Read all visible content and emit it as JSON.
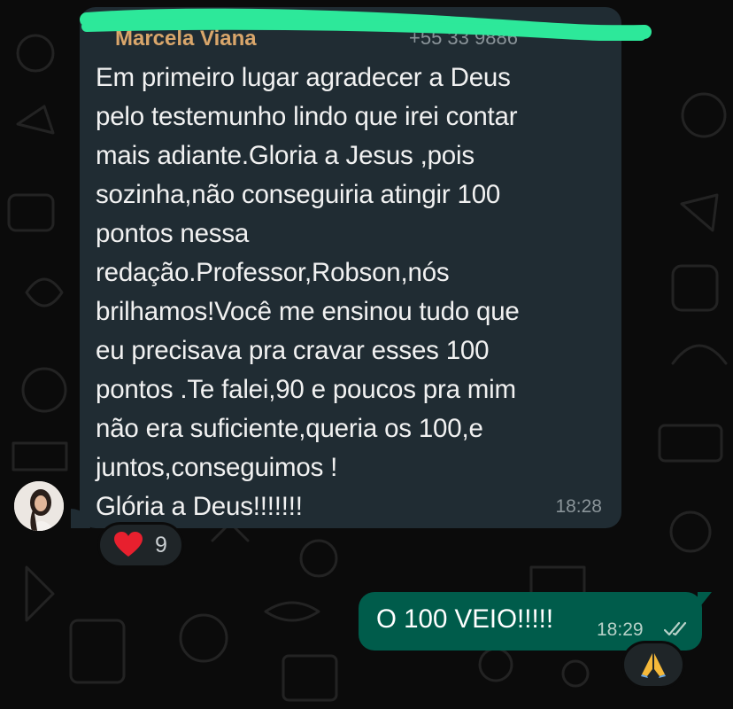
{
  "chat": {
    "incoming": {
      "sender_name": "Marcela Viana",
      "sender_phone": "+55 33 9886",
      "text": "Em primeiro lugar agradecer a Deus\npelo testemunho lindo que irei contar\nmais adiante.Gloria a Jesus ,pois\nsozinha,não conseguiria atingir 100\npontos nessa\nredação.Professor,Robson,nós\nbrilhamos!Você me ensinou tudo que\neu precisava pra cravar esses 100\npontos .Te falei,90 e poucos pra mim\nnão era suficiente,queria os 100,e\njuntos,conseguimos !\nGlória a Deus!!!!!!!",
      "time": "18:28",
      "reaction": {
        "icon": "heart-icon",
        "count": "9"
      },
      "avatar_icon": "avatar"
    },
    "outgoing": {
      "text": "O 100 VEIO!!!!!",
      "time": "18:29",
      "status_icon": "double-check-icon",
      "reaction": {
        "icon": "praying-hands-icon"
      }
    }
  },
  "colors": {
    "background": "#0b0b0b",
    "incoming_bubble": "#202c33",
    "outgoing_bubble": "#005c4b",
    "sender_name": "#d9a66b",
    "highlight": "#2de89a"
  }
}
